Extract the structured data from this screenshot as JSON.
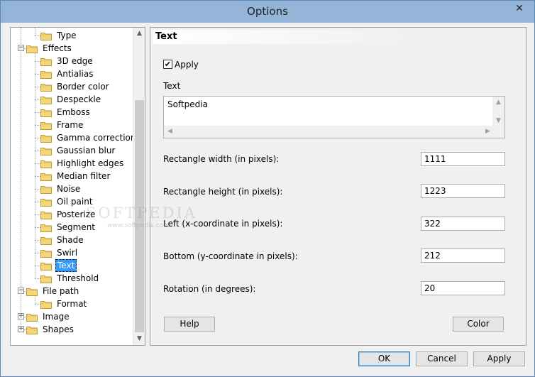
{
  "window": {
    "title": "Options",
    "close_glyph": "✕"
  },
  "tree": {
    "items": [
      {
        "label": "Type",
        "level": 2
      },
      {
        "label": "Effects",
        "level": 1,
        "expander": "−"
      },
      {
        "label": "3D edge",
        "level": 2
      },
      {
        "label": "Antialias",
        "level": 2
      },
      {
        "label": "Border color",
        "level": 2
      },
      {
        "label": "Despeckle",
        "level": 2
      },
      {
        "label": "Emboss",
        "level": 2
      },
      {
        "label": "Frame",
        "level": 2
      },
      {
        "label": "Gamma correction",
        "level": 2
      },
      {
        "label": "Gaussian blur",
        "level": 2
      },
      {
        "label": "Highlight edges",
        "level": 2
      },
      {
        "label": "Median filter",
        "level": 2
      },
      {
        "label": "Noise",
        "level": 2
      },
      {
        "label": "Oil paint",
        "level": 2
      },
      {
        "label": "Posterize",
        "level": 2
      },
      {
        "label": "Segment",
        "level": 2
      },
      {
        "label": "Shade",
        "level": 2
      },
      {
        "label": "Swirl",
        "level": 2
      },
      {
        "label": "Text",
        "level": 2,
        "selected": true
      },
      {
        "label": "Threshold",
        "level": 2
      },
      {
        "label": "File path",
        "level": 1,
        "expander": "−"
      },
      {
        "label": "Format",
        "level": 2
      },
      {
        "label": "Image",
        "level": 1,
        "expander": "+"
      },
      {
        "label": "Shapes",
        "level": 1,
        "expander": "+"
      }
    ],
    "scroll_up_glyph": "▲",
    "scroll_down_glyph": "▼"
  },
  "panel": {
    "header": "Text",
    "apply_label": "Apply",
    "apply_checked": true,
    "check_glyph": "✔",
    "text_label": "Text",
    "text_value": "Softpedia",
    "fields": [
      {
        "label": "Rectangle width (in pixels):",
        "value": "1111"
      },
      {
        "label": "Rectangle height (in pixels):",
        "value": "1223"
      },
      {
        "label": "Left (x-coordinate in pixels):",
        "value": "322"
      },
      {
        "label": "Bottom (y-coordinate in pixels):",
        "value": "212"
      },
      {
        "label": "Rotation (in degrees):",
        "value": "20"
      }
    ],
    "help_label": "Help",
    "color_label": "Color"
  },
  "footer": {
    "ok_label": "OK",
    "cancel_label": "Cancel",
    "apply_label": "Apply"
  },
  "watermark": {
    "text": "SOFTPEDIA",
    "sub": "www.softpedia.com"
  },
  "colors": {
    "titlebar": "#94b4d8",
    "selection": "#3399ff",
    "folder": "#f5d77a"
  }
}
